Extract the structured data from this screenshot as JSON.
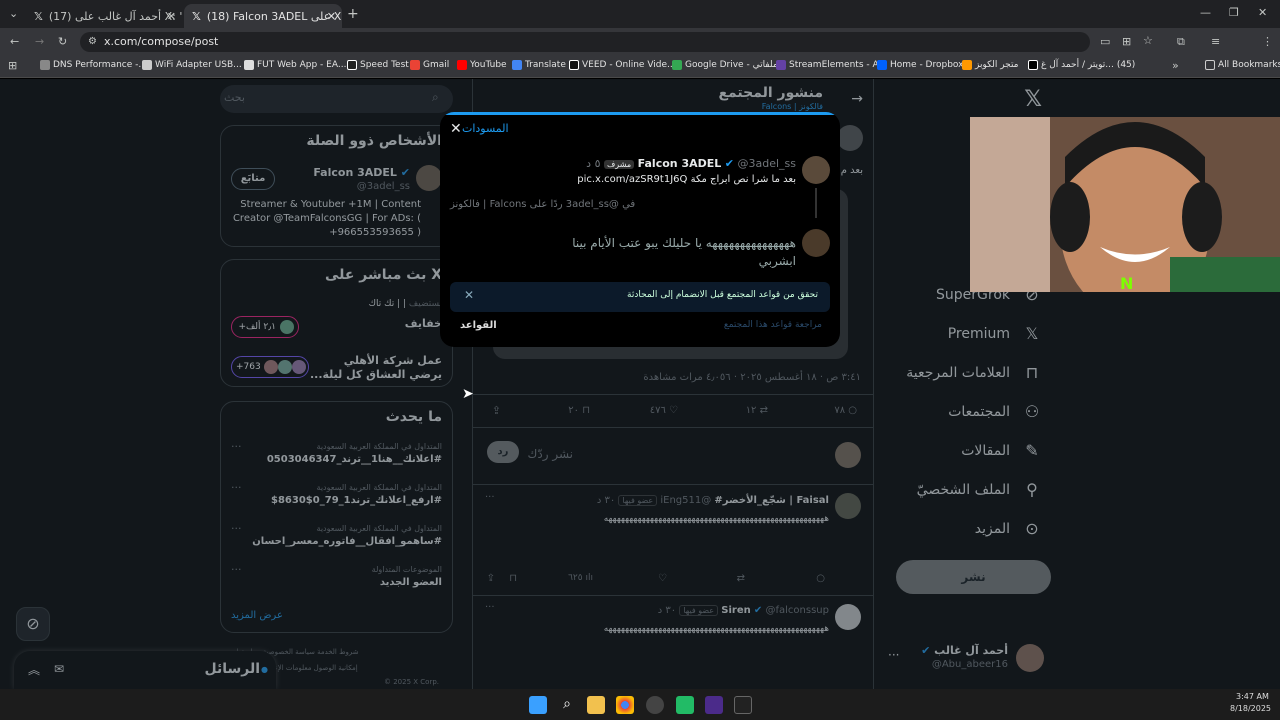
{
  "tabs": [
    {
      "title": "(17) أحمد آل غالب على X: \"مشارك"
    },
    {
      "title": "(18) Falcon 3ADEL على X: \"مكة"
    }
  ],
  "address": "x.com/compose/post",
  "bookmarks": [
    "DNS Performance -...",
    "WiFi Adapter USB...",
    "FUT Web App - EA...",
    "Speed Test",
    "Gmail",
    "YouTube",
    "Translate",
    "VEED - Online Vide...",
    "Google Drive - ملفاتي",
    "StreamElements - A...",
    "Home - Dropbox",
    "متجر الكوبز",
    "تويتر / أحمد آل غ...",
    "(45)",
    "All Bookmarks"
  ],
  "search": {
    "placeholder": "بحث"
  },
  "related": {
    "title": "الأشخاص ذوو الصلة",
    "name": "Falcon 3ADEL",
    "handle": "@3adel_ss",
    "follow": "متابَع",
    "bio": "Streamer & Youtuber +1M | Content Creator @TeamFalconsGG | For ADs: ( +966553593655 )"
  },
  "live": {
    "title": "X بث مباشر على",
    "host_label": "يستضيف",
    "host": "| | تك تاك",
    "topic": "خفايف",
    "count1": "٢٫١ ألف+",
    "topic2": "عمل شركة الأهلي",
    "topic2b": "يرضي العشاق كل ليلة...",
    "count2": "+763"
  },
  "trends": {
    "title": "ما يحدث",
    "items": [
      {
        "meta": "المتداول في المملكة العربية السعودية",
        "name": "#اعلانك__هنا1__ترند_0503046347"
      },
      {
        "meta": "المتداول في المملكة العربية السعودية",
        "name": "#ارفع_اعلانك_ترند1_79_0$8630$"
      },
      {
        "meta": "المتداول في المملكة العربية السعودية",
        "name": "#ساهمو_افقال__فاتوره_معسر_احسان"
      },
      {
        "meta": "الموضوعات المتداولة",
        "name": "العضو الجديد"
      }
    ],
    "more": "عرض المزيد"
  },
  "footer": {
    "l1": "شروط الخدمة   سياسة الخصوصية   سياسة ا...",
    "l2": "إمكانية الوصول   معلومات الإعلانات   المزيد ...",
    "l3": "© 2025 X Corp."
  },
  "messages": {
    "label": "الرسائل"
  },
  "post_header": {
    "title": "منشور المجتمع",
    "sub": "فالكونز | Falcons"
  },
  "post": {
    "meta": "٣:٤١ ص · ١٨ أغسطس ٢٠٢٥ · ٤٫٠٥٦ مرات مشاهدة",
    "replies": "٧٨",
    "reposts": "١٢",
    "likes": "٤٧٦",
    "bookmarks": "٢٠"
  },
  "reply_box": {
    "placeholder": "نشر ردّك",
    "button": "رد"
  },
  "reply1": {
    "name": "Faisal | شجّع_الأخضر#",
    "handle": "@iEng511",
    "badge": "عضو فيها",
    "time": "٣٠ د",
    "text": "هههههههههههههههههههههههههههههههههههههههههههههههههههههه",
    "views": "٦٢٥"
  },
  "reply2": {
    "name": "Siren",
    "handle": "@falconssup",
    "badge": "عضو فيها",
    "time": "٣٠ د",
    "text": "هههههههههههههههههههههههههههههههههههههههههههههههههههههه"
  },
  "nav": {
    "items": [
      "SuperGrok",
      "Premium",
      "العلامات المرجعية",
      "المجتمعات",
      "المقالات",
      "الملف الشخصيّ",
      "المزيد"
    ],
    "post_button": "نشر"
  },
  "account": {
    "name": "أحمد آل غالب",
    "handle": "@Abu_abeer16"
  },
  "modal": {
    "title": "المسودات",
    "name": "Falcon 3ADEL",
    "handle": "@3adel_ss",
    "role": "مشرف",
    "time": "٥ د",
    "text1": "بعد ما شرا نص ابراج مكة",
    "link": "pic.x.com/azSR9t1J6Q",
    "context": "في @3adel_ss ردًا على Falcons | فالكونز",
    "reply": "هههههههههههههههه يا حليلك يبو عتب الأيام بينا ابشربي",
    "rules_notice": "تحقق من قواعد المجتمع قبل الانضمام إلى المحادثة",
    "review": "مراجعة قواعد هذا المجتمع",
    "rules": "القواعد"
  },
  "clock": {
    "time": "3:47 AM",
    "date": "8/18/2025"
  },
  "colors": {
    "accent": "#1d9bf0",
    "bg": "#000000",
    "border": "#2f3336"
  }
}
